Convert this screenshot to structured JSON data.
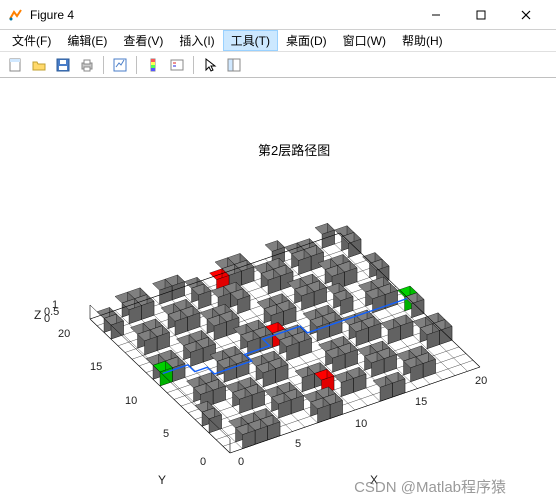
{
  "window": {
    "title": "Figure 4"
  },
  "menubar": {
    "items": [
      {
        "label": "文件(F)"
      },
      {
        "label": "编辑(E)"
      },
      {
        "label": "查看(V)"
      },
      {
        "label": "插入(I)"
      },
      {
        "label": "工具(T)",
        "active": true
      },
      {
        "label": "桌面(D)"
      },
      {
        "label": "窗口(W)"
      },
      {
        "label": "帮助(H)"
      }
    ]
  },
  "toolbar": {
    "icons": [
      "new-file",
      "open-file",
      "save",
      "print",
      "sep",
      "link-figure",
      "sep",
      "color-legend",
      "insert-legend",
      "sep",
      "pointer",
      "docked-figure"
    ]
  },
  "chart_data": {
    "type": "3d-grid-path",
    "title": "第2层路径图",
    "xlabel": "X",
    "ylabel": "Y",
    "zlabel": "Z",
    "xlim": [
      0,
      20
    ],
    "ylim": [
      0,
      20
    ],
    "zlim": [
      0,
      1
    ],
    "xticks": [
      0,
      5,
      10,
      15,
      20
    ],
    "yticks": [
      0,
      5,
      10,
      15,
      20
    ],
    "zticks": [
      0,
      0.5,
      1
    ],
    "grid_size": [
      20,
      20
    ],
    "obstacles": [
      [
        1,
        0
      ],
      [
        2,
        0
      ],
      [
        3,
        0
      ],
      [
        7,
        0
      ],
      [
        8,
        0
      ],
      [
        12,
        0
      ],
      [
        13,
        0
      ],
      [
        1,
        1
      ],
      [
        2,
        1
      ],
      [
        3,
        1
      ],
      [
        7,
        1
      ],
      [
        8,
        1
      ],
      [
        15,
        1
      ],
      [
        16,
        1
      ],
      [
        5,
        2
      ],
      [
        6,
        2
      ],
      [
        10,
        2
      ],
      [
        11,
        2
      ],
      [
        15,
        2
      ],
      [
        16,
        2
      ],
      [
        0,
        3
      ],
      [
        5,
        3
      ],
      [
        6,
        3
      ],
      [
        13,
        3
      ],
      [
        14,
        3
      ],
      [
        0,
        4
      ],
      [
        3,
        4
      ],
      [
        4,
        4
      ],
      [
        8,
        4
      ],
      [
        9,
        4
      ],
      [
        13,
        4
      ],
      [
        14,
        4
      ],
      [
        18,
        4
      ],
      [
        19,
        4
      ],
      [
        3,
        5
      ],
      [
        4,
        5
      ],
      [
        11,
        5
      ],
      [
        12,
        5
      ],
      [
        18,
        5
      ],
      [
        19,
        5
      ],
      [
        1,
        6
      ],
      [
        2,
        6
      ],
      [
        6,
        6
      ],
      [
        7,
        6
      ],
      [
        11,
        6
      ],
      [
        12,
        6
      ],
      [
        16,
        6
      ],
      [
        17,
        6
      ],
      [
        1,
        7
      ],
      [
        2,
        7
      ],
      [
        6,
        7
      ],
      [
        7,
        7
      ],
      [
        14,
        7
      ],
      [
        15,
        7
      ],
      [
        4,
        8
      ],
      [
        5,
        8
      ],
      [
        9,
        8
      ],
      [
        10,
        8
      ],
      [
        14,
        8
      ],
      [
        15,
        8
      ],
      [
        19,
        8
      ],
      [
        4,
        9
      ],
      [
        5,
        9
      ],
      [
        9,
        9
      ],
      [
        10,
        9
      ],
      [
        12,
        9
      ],
      [
        13,
        9
      ],
      [
        19,
        9
      ],
      [
        0,
        10
      ],
      [
        1,
        10
      ],
      [
        7,
        10
      ],
      [
        8,
        10
      ],
      [
        12,
        10
      ],
      [
        13,
        10
      ],
      [
        17,
        10
      ],
      [
        18,
        10
      ],
      [
        0,
        11
      ],
      [
        1,
        11
      ],
      [
        3,
        11
      ],
      [
        4,
        11
      ],
      [
        7,
        11
      ],
      [
        8,
        11
      ],
      [
        15,
        11
      ],
      [
        17,
        11
      ],
      [
        18,
        11
      ],
      [
        3,
        12
      ],
      [
        4,
        12
      ],
      [
        10,
        12
      ],
      [
        11,
        12
      ],
      [
        15,
        12
      ],
      [
        6,
        13
      ],
      [
        7,
        13
      ],
      [
        10,
        13
      ],
      [
        11,
        13
      ],
      [
        13,
        13
      ],
      [
        14,
        13
      ],
      [
        19,
        13
      ],
      [
        1,
        14
      ],
      [
        2,
        14
      ],
      [
        6,
        14
      ],
      [
        7,
        14
      ],
      [
        13,
        14
      ],
      [
        14,
        14
      ],
      [
        16,
        14
      ],
      [
        17,
        14
      ],
      [
        19,
        14
      ],
      [
        1,
        15
      ],
      [
        2,
        15
      ],
      [
        4,
        15
      ],
      [
        5,
        15
      ],
      [
        9,
        15
      ],
      [
        16,
        15
      ],
      [
        17,
        15
      ],
      [
        4,
        16
      ],
      [
        5,
        16
      ],
      [
        8,
        16
      ],
      [
        9,
        16
      ],
      [
        12,
        16
      ],
      [
        13,
        16
      ],
      [
        0,
        17
      ],
      [
        7,
        17
      ],
      [
        12,
        17
      ],
      [
        13,
        17
      ],
      [
        15,
        17
      ],
      [
        16,
        17
      ],
      [
        19,
        17
      ],
      [
        0,
        18
      ],
      [
        2,
        18
      ],
      [
        3,
        18
      ],
      [
        7,
        18
      ],
      [
        10,
        18
      ],
      [
        11,
        18
      ],
      [
        15,
        18
      ],
      [
        16,
        18
      ],
      [
        19,
        18
      ],
      [
        2,
        19
      ],
      [
        3,
        19
      ],
      [
        5,
        19
      ],
      [
        6,
        19
      ],
      [
        10,
        19
      ],
      [
        11,
        19
      ],
      [
        14,
        19
      ],
      [
        18,
        19
      ]
    ],
    "start_points": [
      [
        0,
        10
      ],
      [
        19,
        9
      ]
    ],
    "goal_points": [
      [
        9,
        18
      ],
      [
        9,
        10
      ],
      [
        9,
        3
      ]
    ],
    "path_color": "#1060ff",
    "obstacle_color": "#808080",
    "start_color": "#00d000",
    "goal_color": "#ff0000",
    "path": [
      [
        0,
        10
      ],
      [
        1,
        10
      ],
      [
        2,
        10
      ],
      [
        2,
        9
      ],
      [
        3,
        9
      ],
      [
        3,
        8
      ],
      [
        4,
        8
      ],
      [
        5,
        8
      ],
      [
        6,
        8
      ],
      [
        6,
        9
      ],
      [
        7,
        9
      ],
      [
        8,
        9
      ],
      [
        8,
        10
      ],
      [
        9,
        10
      ],
      [
        10,
        10
      ],
      [
        11,
        10
      ],
      [
        11,
        9
      ],
      [
        12,
        9
      ],
      [
        13,
        9
      ],
      [
        14,
        9
      ],
      [
        15,
        9
      ],
      [
        16,
        9
      ],
      [
        17,
        9
      ],
      [
        18,
        9
      ],
      [
        19,
        9
      ]
    ]
  },
  "watermark": "CSDN @Matlab程序猿"
}
